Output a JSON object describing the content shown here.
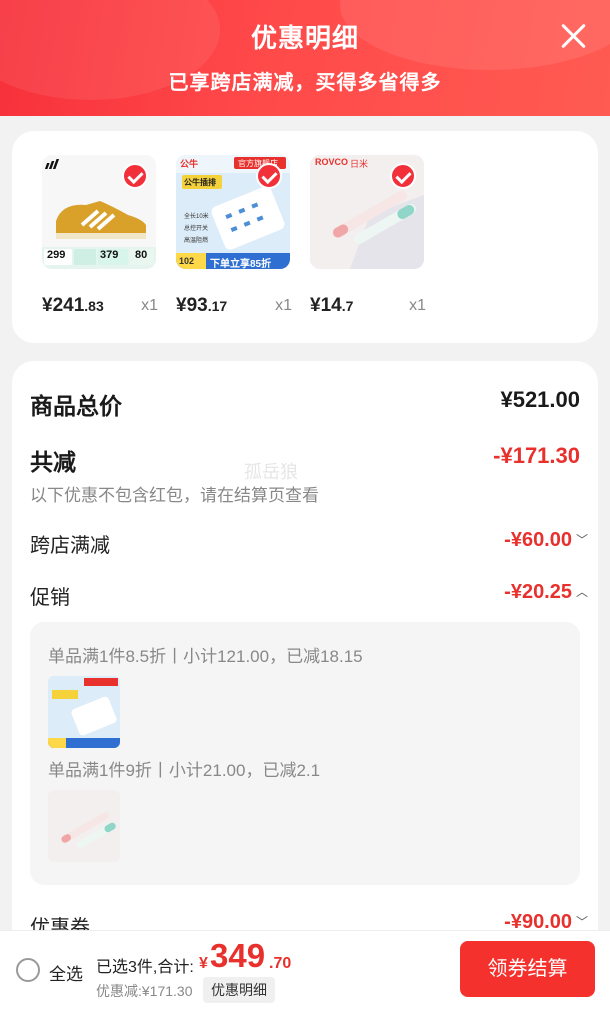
{
  "header": {
    "title": "优惠明细",
    "subtitle": "已享跨店满减，买得多省得多",
    "close_icon": "close-icon"
  },
  "products": [
    {
      "price_int": "¥241",
      "price_dec": ".83",
      "qty": "x1",
      "selected": true,
      "image": "shoe"
    },
    {
      "price_int": "¥93",
      "price_dec": ".17",
      "qty": "x1",
      "selected": true,
      "image": "power-strip"
    },
    {
      "price_int": "¥14",
      "price_dec": ".7",
      "qty": "x1",
      "selected": true,
      "image": "pen"
    }
  ],
  "product_badges": {
    "shoe_price_1": "299",
    "shoe_price_2": "379",
    "shoe_price_3": "80",
    "strip_brand": "公牛",
    "strip_store": "官方旗舰店",
    "strip_title": "公牛插排",
    "strip_feature_1": "全长10米",
    "strip_feature_2": "总控开关",
    "strip_feature_3": "高温阻燃",
    "strip_price": "102",
    "strip_promo": "下单立享85折",
    "pen_brand": "ROVCO",
    "pen_brand_cn": "日米"
  },
  "details": {
    "total_label": "商品总价",
    "total_value": "¥521.00",
    "reduce_label": "共减",
    "reduce_value": "-¥171.30",
    "reduce_note": "以下优惠不包含红包，请在结算页查看",
    "cross_store_label": "跨店满减",
    "cross_store_value": "-¥60.00",
    "promo_label": "促销",
    "promo_value": "-¥20.25",
    "promo_items": [
      {
        "text": "单品满1件8.5折丨小计121.00，已减18.15"
      },
      {
        "text": "单品满1件9折丨小计21.00，已减2.1"
      }
    ],
    "coupon_label": "优惠券",
    "coupon_value": "-¥90.00",
    "watermark": "孤岳狼"
  },
  "footer": {
    "select_all": "全选",
    "summary": "已选3件,合计:",
    "total_symbol": "¥",
    "total_int": "349",
    "total_dec": ".70",
    "saved": "优惠减:¥171.30",
    "detail_button": "优惠明细",
    "checkout_button": "领券结算"
  },
  "colors": {
    "accent": "#f5312e",
    "header_red": "#f7303a",
    "discount_red": "#e8302c"
  }
}
